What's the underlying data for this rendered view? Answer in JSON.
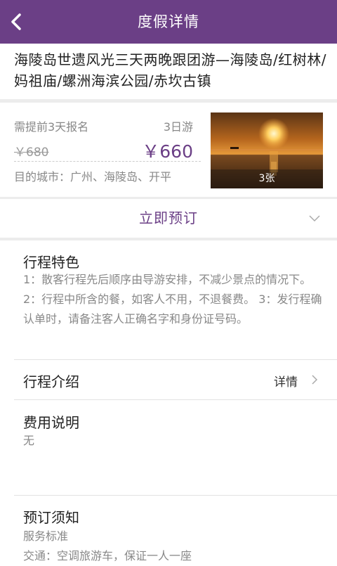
{
  "header": {
    "title": "度假详情"
  },
  "tour": {
    "title": "海陵岛世遗风光三天两晚跟团游—海陵岛/红树林/妈祖庙/螺洲海滨公园/赤坎古镇",
    "advance_notice": "需提前3天报名",
    "duration": "3日游",
    "original_price": "￥680",
    "price": "￥660",
    "destinations": "目的城市：广州、海陵岛、开平",
    "photo_count": "3张"
  },
  "booking": {
    "label": "立即预订"
  },
  "features": {
    "title": "行程特色",
    "body": "1：散客行程先后顺序由导游安排，不减少景点的情况下。 2：行程中所含的餐，如客人不用，不退餐费。 3：发行程确认单时，请备注客人正确名字和身份证号码。"
  },
  "itinerary": {
    "title": "行程介绍",
    "detail_label": "详情"
  },
  "fees": {
    "title": "费用说明",
    "body": "无"
  },
  "notice": {
    "title": "预订须知",
    "subtitle": "服务标准",
    "line1": "交通：空调旅游车，保证一人一座"
  },
  "colors": {
    "accent": "#6b3f86",
    "muted": "#888888"
  },
  "icons": {
    "back": "chevron-left-icon",
    "expand": "chevron-down-icon",
    "detail": "chevron-right-icon"
  }
}
